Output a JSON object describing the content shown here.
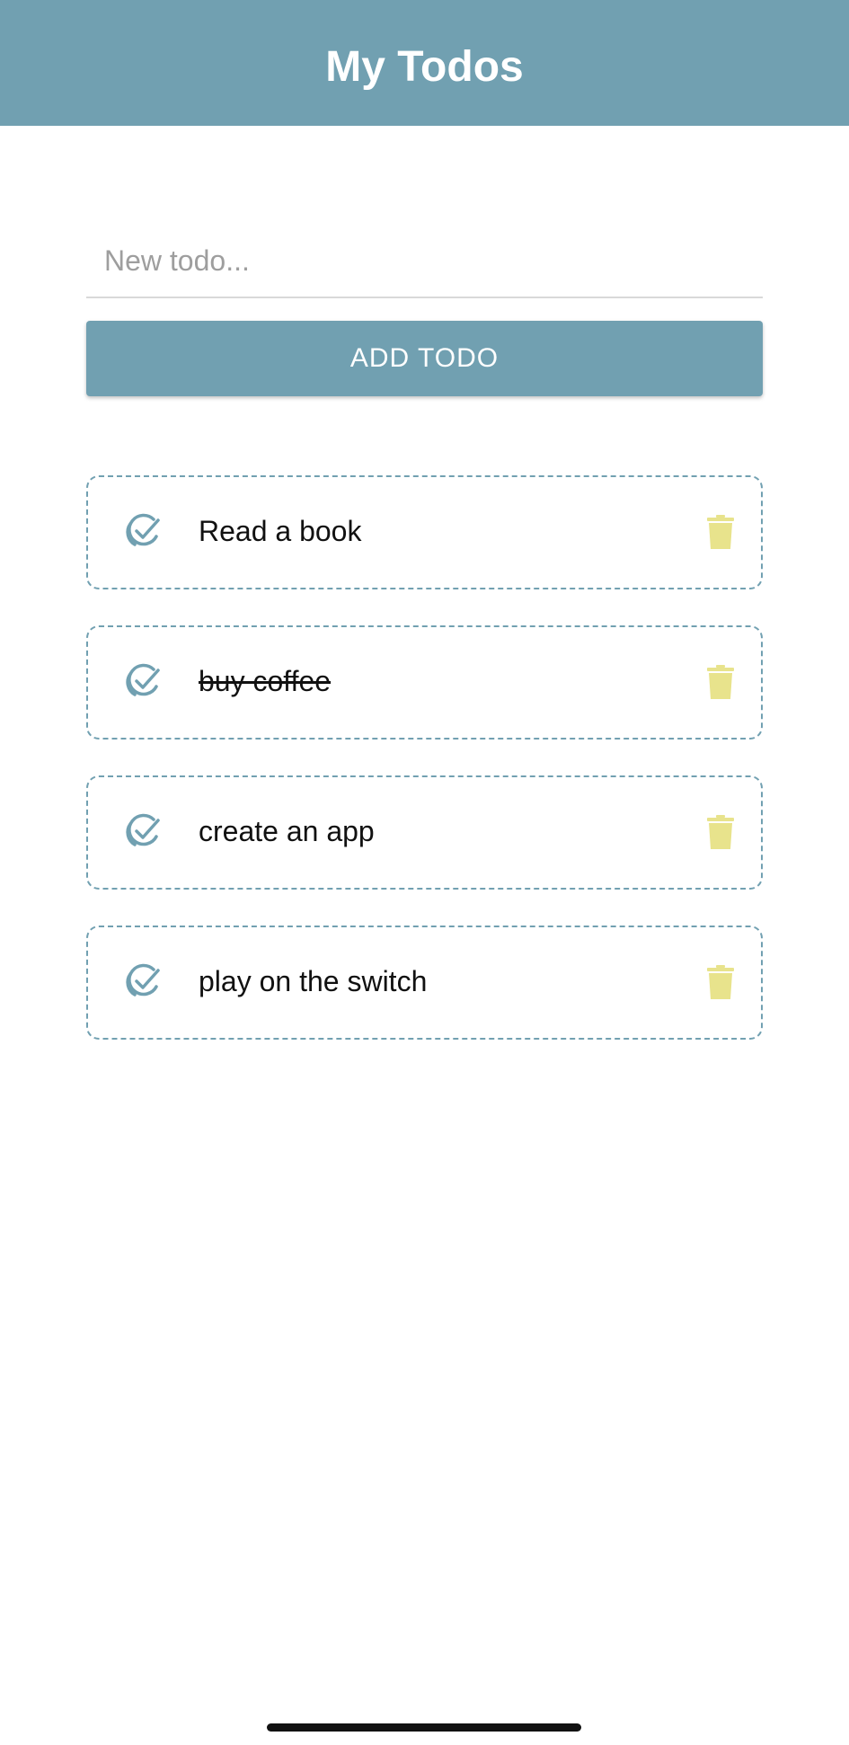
{
  "header": {
    "title": "My Todos"
  },
  "new_todo": {
    "placeholder": "New todo...",
    "value": ""
  },
  "add_button": {
    "label": "ADD TODO"
  },
  "todos": [
    {
      "text": "Read a book",
      "completed": false
    },
    {
      "text": "buy coffee",
      "completed": true
    },
    {
      "text": "create an app",
      "completed": false
    },
    {
      "text": "play on the switch",
      "completed": false
    }
  ],
  "icons": {
    "complete": "check-circle-icon",
    "delete": "trash-icon"
  },
  "colors": {
    "primary": "#71a0b1",
    "trash": "#e8e38c",
    "text": "#111111",
    "placeholder": "#9e9e9e"
  }
}
